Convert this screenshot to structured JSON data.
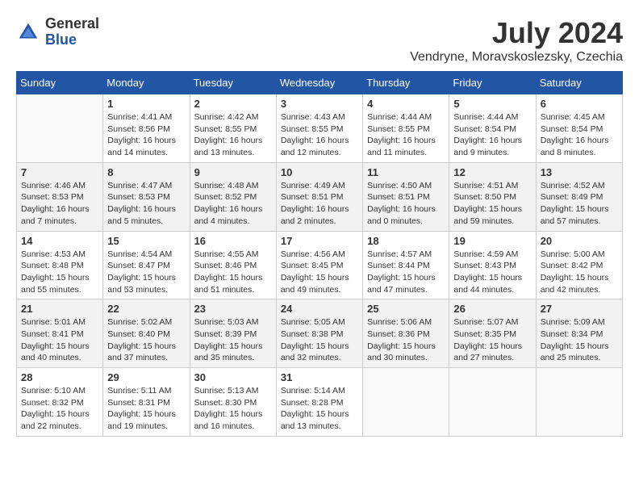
{
  "header": {
    "logo_general": "General",
    "logo_blue": "Blue",
    "month_year": "July 2024",
    "location": "Vendryne, Moravskoslezsky, Czechia"
  },
  "days_of_week": [
    "Sunday",
    "Monday",
    "Tuesday",
    "Wednesday",
    "Thursday",
    "Friday",
    "Saturday"
  ],
  "weeks": [
    [
      {
        "day": "",
        "info": ""
      },
      {
        "day": "1",
        "info": "Sunrise: 4:41 AM\nSunset: 8:56 PM\nDaylight: 16 hours\nand 14 minutes."
      },
      {
        "day": "2",
        "info": "Sunrise: 4:42 AM\nSunset: 8:55 PM\nDaylight: 16 hours\nand 13 minutes."
      },
      {
        "day": "3",
        "info": "Sunrise: 4:43 AM\nSunset: 8:55 PM\nDaylight: 16 hours\nand 12 minutes."
      },
      {
        "day": "4",
        "info": "Sunrise: 4:44 AM\nSunset: 8:55 PM\nDaylight: 16 hours\nand 11 minutes."
      },
      {
        "day": "5",
        "info": "Sunrise: 4:44 AM\nSunset: 8:54 PM\nDaylight: 16 hours\nand 9 minutes."
      },
      {
        "day": "6",
        "info": "Sunrise: 4:45 AM\nSunset: 8:54 PM\nDaylight: 16 hours\nand 8 minutes."
      }
    ],
    [
      {
        "day": "7",
        "info": "Sunrise: 4:46 AM\nSunset: 8:53 PM\nDaylight: 16 hours\nand 7 minutes."
      },
      {
        "day": "8",
        "info": "Sunrise: 4:47 AM\nSunset: 8:53 PM\nDaylight: 16 hours\nand 5 minutes."
      },
      {
        "day": "9",
        "info": "Sunrise: 4:48 AM\nSunset: 8:52 PM\nDaylight: 16 hours\nand 4 minutes."
      },
      {
        "day": "10",
        "info": "Sunrise: 4:49 AM\nSunset: 8:51 PM\nDaylight: 16 hours\nand 2 minutes."
      },
      {
        "day": "11",
        "info": "Sunrise: 4:50 AM\nSunset: 8:51 PM\nDaylight: 16 hours\nand 0 minutes."
      },
      {
        "day": "12",
        "info": "Sunrise: 4:51 AM\nSunset: 8:50 PM\nDaylight: 15 hours\nand 59 minutes."
      },
      {
        "day": "13",
        "info": "Sunrise: 4:52 AM\nSunset: 8:49 PM\nDaylight: 15 hours\nand 57 minutes."
      }
    ],
    [
      {
        "day": "14",
        "info": "Sunrise: 4:53 AM\nSunset: 8:48 PM\nDaylight: 15 hours\nand 55 minutes."
      },
      {
        "day": "15",
        "info": "Sunrise: 4:54 AM\nSunset: 8:47 PM\nDaylight: 15 hours\nand 53 minutes."
      },
      {
        "day": "16",
        "info": "Sunrise: 4:55 AM\nSunset: 8:46 PM\nDaylight: 15 hours\nand 51 minutes."
      },
      {
        "day": "17",
        "info": "Sunrise: 4:56 AM\nSunset: 8:45 PM\nDaylight: 15 hours\nand 49 minutes."
      },
      {
        "day": "18",
        "info": "Sunrise: 4:57 AM\nSunset: 8:44 PM\nDaylight: 15 hours\nand 47 minutes."
      },
      {
        "day": "19",
        "info": "Sunrise: 4:59 AM\nSunset: 8:43 PM\nDaylight: 15 hours\nand 44 minutes."
      },
      {
        "day": "20",
        "info": "Sunrise: 5:00 AM\nSunset: 8:42 PM\nDaylight: 15 hours\nand 42 minutes."
      }
    ],
    [
      {
        "day": "21",
        "info": "Sunrise: 5:01 AM\nSunset: 8:41 PM\nDaylight: 15 hours\nand 40 minutes."
      },
      {
        "day": "22",
        "info": "Sunrise: 5:02 AM\nSunset: 8:40 PM\nDaylight: 15 hours\nand 37 minutes."
      },
      {
        "day": "23",
        "info": "Sunrise: 5:03 AM\nSunset: 8:39 PM\nDaylight: 15 hours\nand 35 minutes."
      },
      {
        "day": "24",
        "info": "Sunrise: 5:05 AM\nSunset: 8:38 PM\nDaylight: 15 hours\nand 32 minutes."
      },
      {
        "day": "25",
        "info": "Sunrise: 5:06 AM\nSunset: 8:36 PM\nDaylight: 15 hours\nand 30 minutes."
      },
      {
        "day": "26",
        "info": "Sunrise: 5:07 AM\nSunset: 8:35 PM\nDaylight: 15 hours\nand 27 minutes."
      },
      {
        "day": "27",
        "info": "Sunrise: 5:09 AM\nSunset: 8:34 PM\nDaylight: 15 hours\nand 25 minutes."
      }
    ],
    [
      {
        "day": "28",
        "info": "Sunrise: 5:10 AM\nSunset: 8:32 PM\nDaylight: 15 hours\nand 22 minutes."
      },
      {
        "day": "29",
        "info": "Sunrise: 5:11 AM\nSunset: 8:31 PM\nDaylight: 15 hours\nand 19 minutes."
      },
      {
        "day": "30",
        "info": "Sunrise: 5:13 AM\nSunset: 8:30 PM\nDaylight: 15 hours\nand 16 minutes."
      },
      {
        "day": "31",
        "info": "Sunrise: 5:14 AM\nSunset: 8:28 PM\nDaylight: 15 hours\nand 13 minutes."
      },
      {
        "day": "",
        "info": ""
      },
      {
        "day": "",
        "info": ""
      },
      {
        "day": "",
        "info": ""
      }
    ]
  ]
}
